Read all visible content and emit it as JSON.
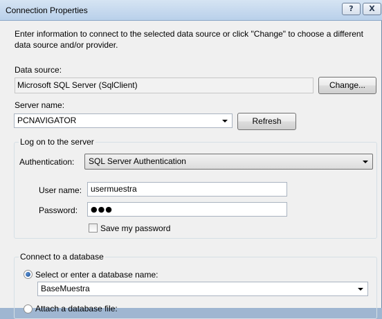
{
  "window": {
    "title": "Connection Properties",
    "help_label": "?",
    "close_label": "X"
  },
  "intro": "Enter information to connect to the selected data source or click \"Change\" to choose a different data source and/or provider.",
  "data_source": {
    "label": "Data source:",
    "value": "Microsoft SQL Server (SqlClient)",
    "change_label": "Change..."
  },
  "server": {
    "label": "Server name:",
    "value": "PCNAVIGATOR",
    "refresh_label": "Refresh"
  },
  "logon": {
    "title": "Log on to the server",
    "auth_label": "Authentication:",
    "auth_value": "SQL Server Authentication",
    "user_label": "User name:",
    "user_value": "usermuestra",
    "password_label": "Password:",
    "password_value": "●●●",
    "save_password_label": "Save my password"
  },
  "database": {
    "title": "Connect to a database",
    "select_label": "Select or enter a database name:",
    "db_value": "BaseMuestra",
    "attach_label": "Attach a database file:"
  }
}
